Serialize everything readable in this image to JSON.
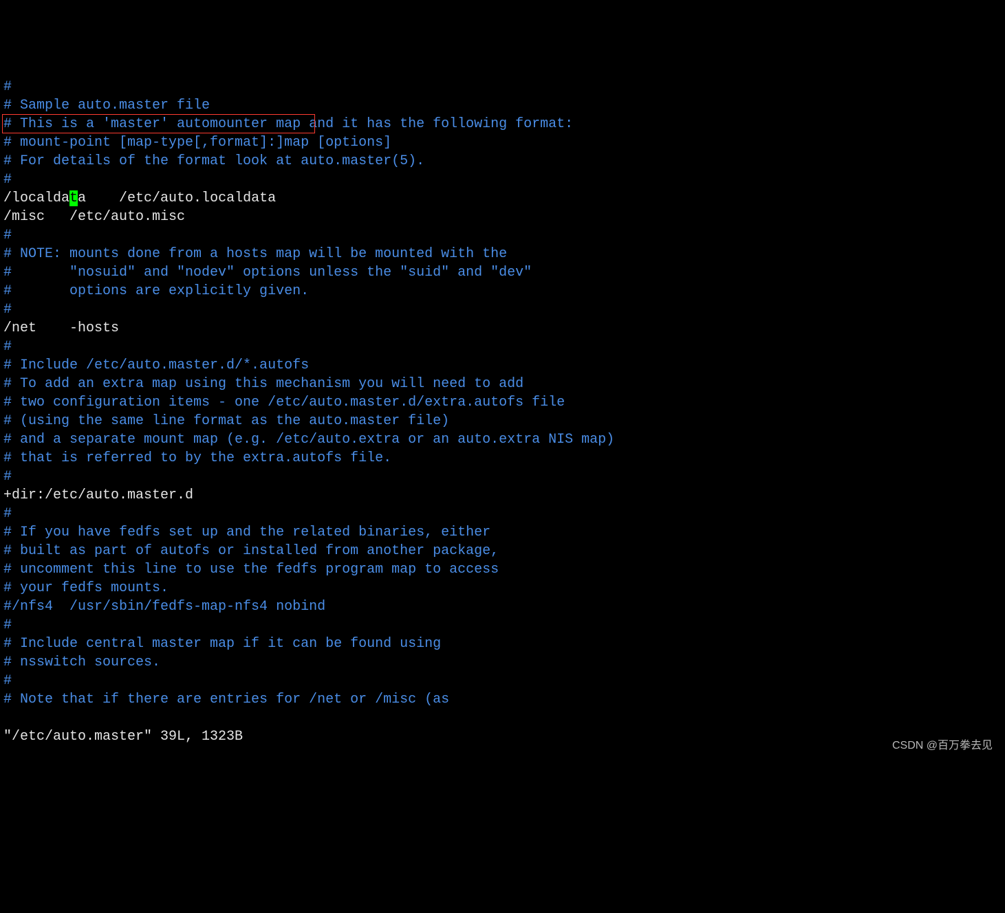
{
  "lines": [
    {
      "cls": "c-comment",
      "text": "#"
    },
    {
      "cls": "c-comment",
      "text": "# Sample auto.master file"
    },
    {
      "cls": "c-comment",
      "text": "# This is a 'master' automounter map and it has the following format:"
    },
    {
      "cls": "c-comment",
      "text": "# mount-point [map-type[,format]:]map [options]"
    },
    {
      "cls": "c-comment",
      "text": "# For details of the format look at auto.master(5)."
    },
    {
      "cls": "c-comment",
      "text": "#"
    },
    {
      "cls": "cursor-line",
      "pre": "/localda",
      "ch": "t",
      "post": "a    /etc/auto.localdata"
    },
    {
      "cls": "c-white",
      "text": "/misc   /etc/auto.misc"
    },
    {
      "cls": "c-comment",
      "text": "#"
    },
    {
      "cls": "c-comment",
      "text": "# NOTE: mounts done from a hosts map will be mounted with the"
    },
    {
      "cls": "c-comment",
      "text": "#       \"nosuid\" and \"nodev\" options unless the \"suid\" and \"dev\""
    },
    {
      "cls": "c-comment",
      "text": "#       options are explicitly given."
    },
    {
      "cls": "c-comment",
      "text": "#"
    },
    {
      "cls": "c-white",
      "text": "/net    -hosts"
    },
    {
      "cls": "c-comment",
      "text": "#"
    },
    {
      "cls": "c-comment",
      "text": "# Include /etc/auto.master.d/*.autofs"
    },
    {
      "cls": "c-comment",
      "text": "# To add an extra map using this mechanism you will need to add"
    },
    {
      "cls": "c-comment",
      "text": "# two configuration items - one /etc/auto.master.d/extra.autofs file"
    },
    {
      "cls": "c-comment",
      "text": "# (using the same line format as the auto.master file)"
    },
    {
      "cls": "c-comment",
      "text": "# and a separate mount map (e.g. /etc/auto.extra or an auto.extra NIS map)"
    },
    {
      "cls": "c-comment",
      "text": "# that is referred to by the extra.autofs file."
    },
    {
      "cls": "c-comment",
      "text": "#"
    },
    {
      "cls": "c-white",
      "text": "+dir:/etc/auto.master.d"
    },
    {
      "cls": "c-comment",
      "text": "#"
    },
    {
      "cls": "c-comment",
      "text": "# If you have fedfs set up and the related binaries, either"
    },
    {
      "cls": "c-comment",
      "text": "# built as part of autofs or installed from another package,"
    },
    {
      "cls": "c-comment",
      "text": "# uncomment this line to use the fedfs program map to access"
    },
    {
      "cls": "c-comment",
      "text": "# your fedfs mounts."
    },
    {
      "cls": "c-comment",
      "text": "#/nfs4  /usr/sbin/fedfs-map-nfs4 nobind"
    },
    {
      "cls": "c-comment",
      "text": "#"
    },
    {
      "cls": "c-comment",
      "text": "# Include central master map if it can be found using"
    },
    {
      "cls": "c-comment",
      "text": "# nsswitch sources."
    },
    {
      "cls": "c-comment",
      "text": "#"
    },
    {
      "cls": "c-comment",
      "text": "# Note that if there are entries for /net or /misc (as"
    }
  ],
  "status": "\"/etc/auto.master\" 39L, 1323B",
  "watermark": "CSDN @百万拳去见"
}
